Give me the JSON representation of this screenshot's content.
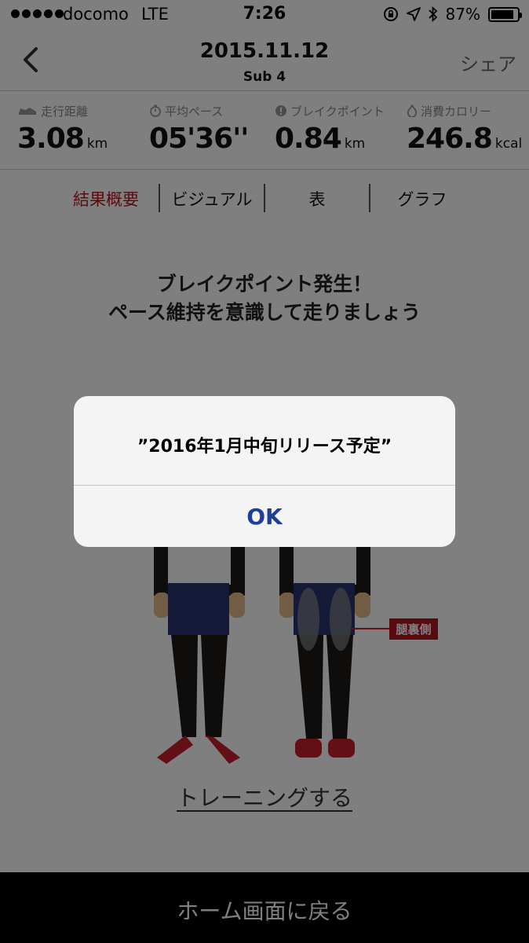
{
  "status_bar": {
    "carrier": "docomo",
    "network": "LTE",
    "time": "7:26",
    "battery_percent": "87%",
    "battery_level": 0.87
  },
  "nav": {
    "title": "2015.11.12",
    "subtitle": "Sub 4",
    "share_label": "シェア",
    "back_icon": "chevron-left-icon"
  },
  "stats": [
    {
      "label": "走行距離",
      "value": "3.08",
      "unit": "km",
      "icon": "shoe-icon"
    },
    {
      "label": "平均ペース",
      "value": "05'36''",
      "unit": "",
      "icon": "stopwatch-icon"
    },
    {
      "label": "ブレイクポイント",
      "value": "0.84",
      "unit": "km",
      "icon": "alert-icon"
    },
    {
      "label": "消費カロリー",
      "value": "246.8",
      "unit": "kcal",
      "icon": "flame-icon"
    }
  ],
  "tabs": [
    {
      "label": "結果概要",
      "active": true
    },
    {
      "label": "ビジュアル",
      "active": false
    },
    {
      "label": "表",
      "active": false
    },
    {
      "label": "グラフ",
      "active": false
    }
  ],
  "main": {
    "message_line1": "ブレイクポイント発生！",
    "message_line2": "ペース維持を意識して走りましょう",
    "hamstring_label": "腿裏側",
    "training_link": "トレーニングする"
  },
  "home_button": "ホーム画面に戻る",
  "alert": {
    "message": "”2016年1月中旬リリース予定”",
    "ok_label": "OK"
  },
  "colors": {
    "accent_red": "#b3141c",
    "alert_ok_blue": "#1d3e9b",
    "shorts_navy": "#2b3470",
    "tights_black": "#1e1a18",
    "skin": "#e7b98a"
  }
}
